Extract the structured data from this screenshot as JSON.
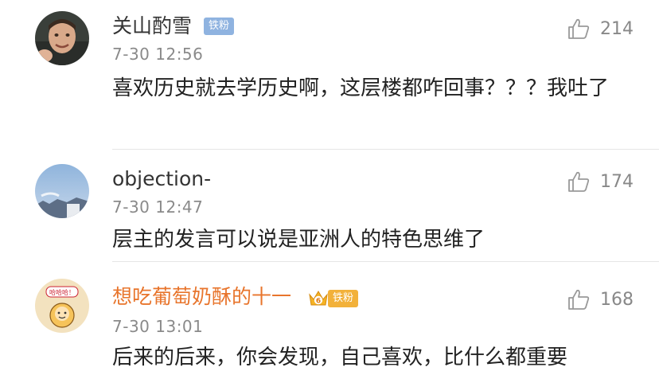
{
  "comments": [
    {
      "username": "关山酌雪",
      "badge": "铁粉",
      "timestamp": "7-30 12:56",
      "text": "喜欢历史就去学历史啊，这层楼都咋回事？？？我吐了",
      "likes": "214",
      "avatar_icon": "user-photo-avatar"
    },
    {
      "username": "objection-",
      "timestamp": "7-30 12:47",
      "text": "层主的发言可以说是亚洲人的特色思维了",
      "likes": "174",
      "avatar_icon": "sky-photo-avatar"
    },
    {
      "username": "想吃葡萄奶酥的十一",
      "badge": "铁粉",
      "level": "6",
      "timestamp": "7-30 13:01",
      "text": "后来的后来，你会发现，自己喜欢，比什么都重要",
      "likes": "168",
      "avatar_icon": "cartoon-avatar",
      "avatar_caption": "哈哈哈！"
    }
  ],
  "colors": {
    "vip_name": "#e8752c",
    "badge_blue": "#8fb3e0",
    "badge_gold": "#f2b13a",
    "meta_gray": "#8a8a8a"
  }
}
